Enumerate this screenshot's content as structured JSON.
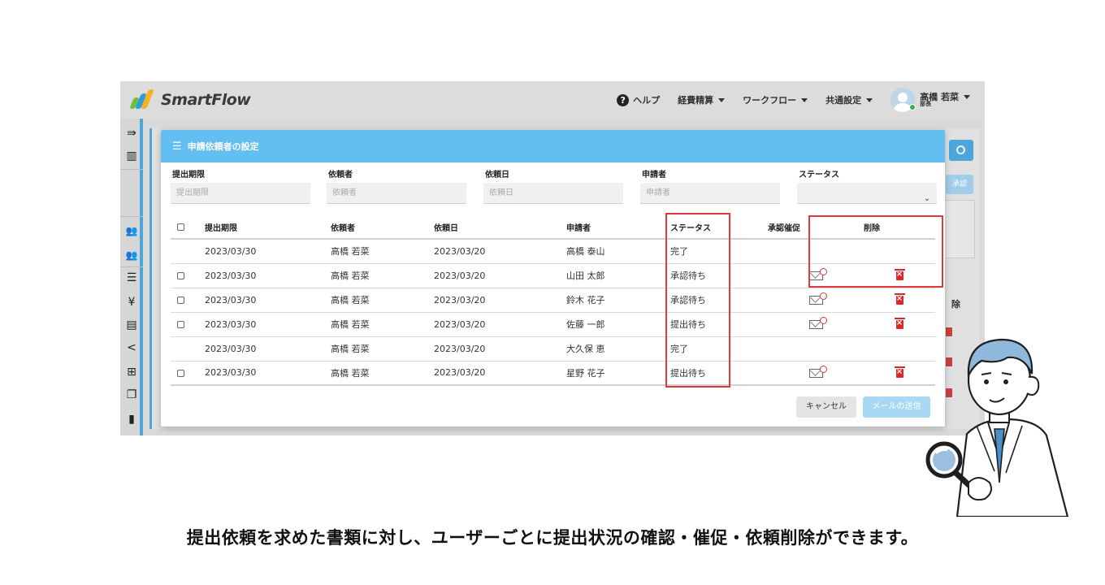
{
  "app": {
    "logo_text": "SmartFlow",
    "brand_colors": [
      "#6fbf3f",
      "#2a9fd8",
      "#f5b21b"
    ]
  },
  "topnav": {
    "help": "ヘルプ",
    "expense": "経費精算",
    "workflow": "ワークフロー",
    "common_settings": "共通設定",
    "user_name": "高橋 若菜",
    "user_role": "部長"
  },
  "sidebar": {
    "icons": [
      "menu-expand-icon",
      "building-icon",
      "users-icon",
      "users-icon",
      "list-icon",
      "yen-icon",
      "document-icon",
      "share-icon",
      "grid-icon",
      "copy-icon",
      "file-icon"
    ]
  },
  "background": {
    "approve_btn": "承認",
    "delete_header": "除"
  },
  "modal": {
    "title": "申請依頼者の設定",
    "filters": {
      "deadline_label": "提出期限",
      "deadline_placeholder": "提出期限",
      "requester_label": "依頼者",
      "requester_placeholder": "依頼者",
      "request_date_label": "依頼日",
      "request_date_placeholder": "依頼日",
      "applicant_label": "申請者",
      "applicant_placeholder": "申請者",
      "status_label": "ステータス",
      "status_value": ""
    },
    "table": {
      "headers": {
        "deadline": "提出期限",
        "requester": "依頼者",
        "request_date": "依頼日",
        "applicant": "申請者",
        "status": "ステータス",
        "remind": "承認催促",
        "delete": "削除"
      },
      "rows": [
        {
          "deadline": "2023/03/30",
          "requester": "高橋 若菜",
          "request_date": "2023/03/20",
          "applicant": "高橋 泰山",
          "status": "完了"
        },
        {
          "deadline": "2023/03/30",
          "requester": "高橋 若菜",
          "request_date": "2023/03/20",
          "applicant": "山田 太郎",
          "status": "承認待ち"
        },
        {
          "deadline": "2023/03/30",
          "requester": "高橋 若菜",
          "request_date": "2023/03/20",
          "applicant": "鈴木 花子",
          "status": "承認待ち"
        },
        {
          "deadline": "2023/03/30",
          "requester": "高橋 若菜",
          "request_date": "2023/03/20",
          "applicant": "佐藤 一郎",
          "status": "提出待ち"
        },
        {
          "deadline": "2023/03/30",
          "requester": "高橋 若菜",
          "request_date": "2023/03/20",
          "applicant": "大久保 恵",
          "status": "完了"
        },
        {
          "deadline": "2023/03/30",
          "requester": "高橋 若菜",
          "request_date": "2023/03/20",
          "applicant": "星野 花子",
          "status": "提出待ち"
        }
      ]
    },
    "cancel_button": "キャンセル",
    "send_button": "メールの送信"
  },
  "caption": "提出依頼を求めた書類に対し、ユーザーごとに提出状況の確認・催促・依頼削除ができます。",
  "colors": {
    "header_blue": "#63bff1",
    "highlight_red": "#e23a3a",
    "trash_red": "#d72a2a"
  }
}
